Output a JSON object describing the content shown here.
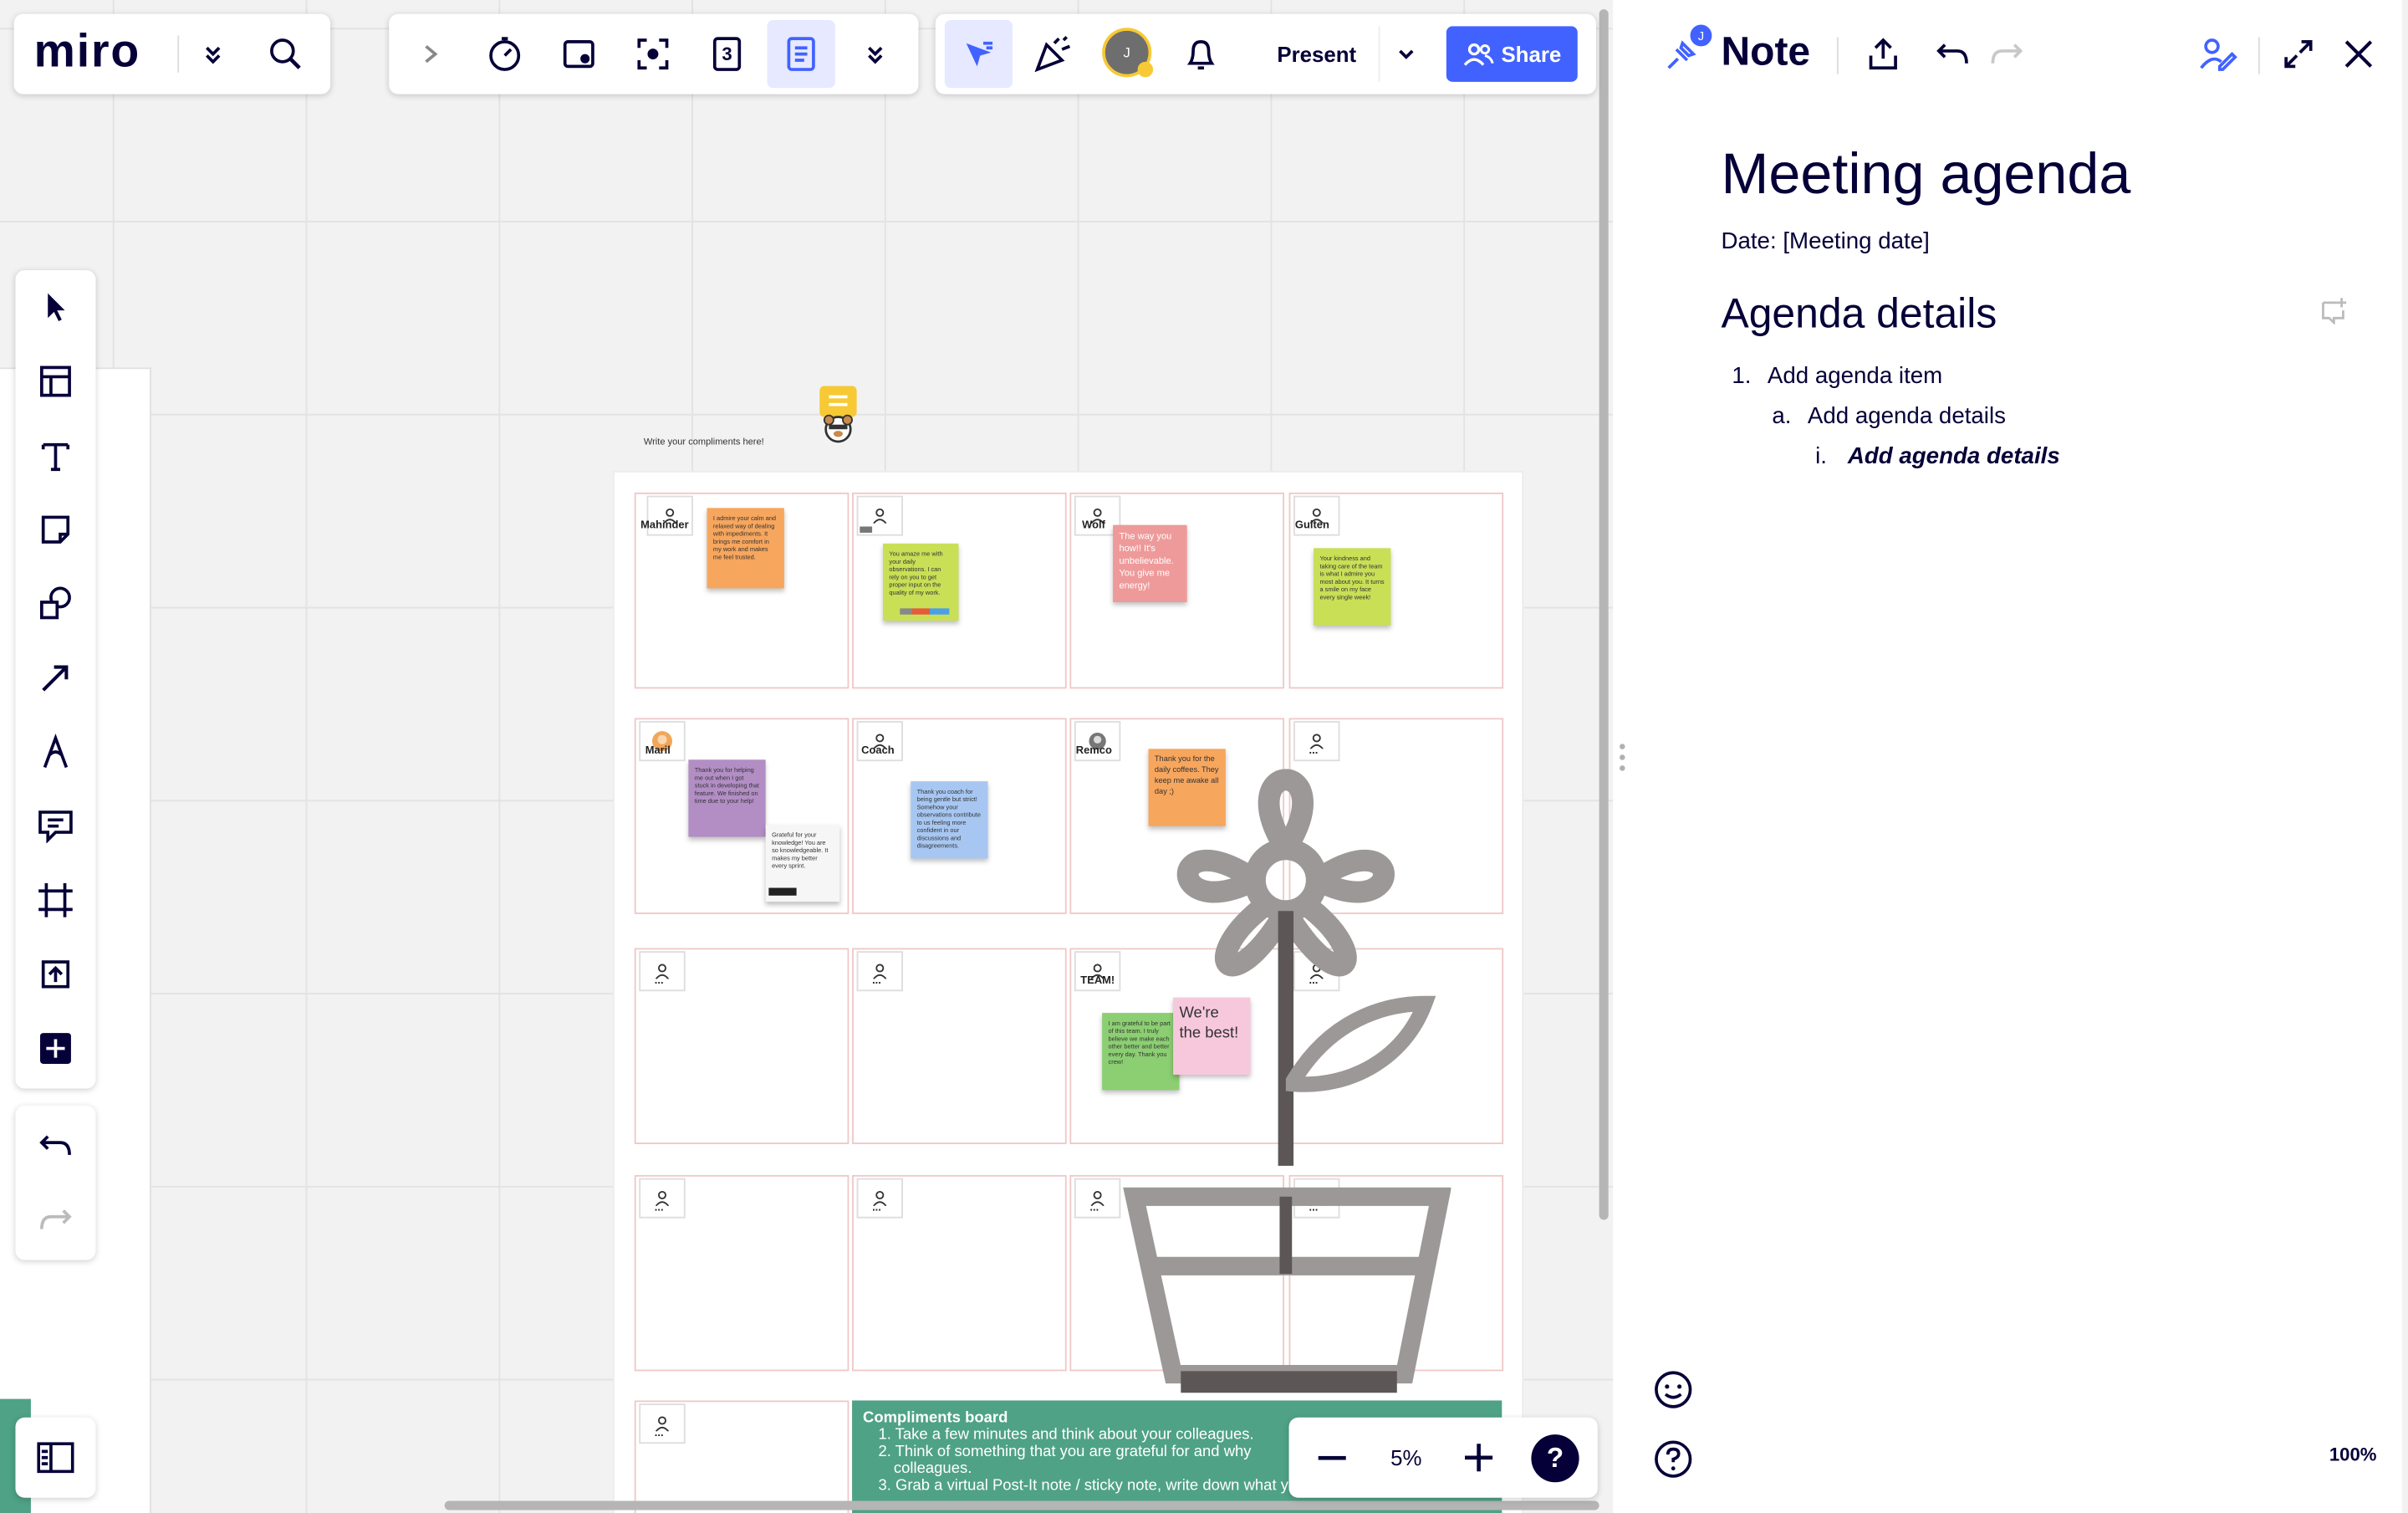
{
  "brand": {
    "logo": "miro"
  },
  "colors": {
    "accent": "#4262ff",
    "footer": "#4fa286",
    "flower": "#9c9898",
    "flower_dark": "#5c5656"
  },
  "toolbar": {
    "present_label": "Present",
    "share_label": "Share",
    "user_initial": "J",
    "timer_number": "3"
  },
  "board": {
    "instruction": "Write your compliments here!",
    "people": [
      {
        "name": "Mahinder"
      },
      {
        "name": ""
      },
      {
        "name": "Wolf"
      },
      {
        "name": "Gulten"
      },
      {
        "name": "Maril"
      },
      {
        "name": "Coach"
      },
      {
        "name": "Remco"
      },
      {
        "name": "..."
      },
      {
        "name": "..."
      },
      {
        "name": "..."
      },
      {
        "name": "TEAM!"
      },
      {
        "name": "..."
      },
      {
        "name": "..."
      },
      {
        "name": "..."
      },
      {
        "name": "..."
      },
      {
        "name": "..."
      },
      {
        "name": "..."
      }
    ],
    "stickies": {
      "mahinder": "I admire your calm and relaxed way of dealing with impediments. It brings me comfort in my work and makes me feel trusted.",
      "p2": "You amaze me with your daily observations. I can rely on you to get proper input on the quality of my work.",
      "wolf": "The way you how!! It's unbelievable. You give me energy!",
      "gulten": "Your kindness and taking care of the team is what I admire you most about you. It turns a smile on my face every single week!",
      "maril_1": "Thank you for helping me out when I got stuck in developing that feature. We finished on time due to your help!",
      "maril_2": "Grateful for your knowledge! You are so knowledgeable. It makes my better every sprint.",
      "coach": "Thank you coach for being gentle but strict! Somehow your observations contribute to us feeling more confident in our discussions and disagreements.",
      "remco": "Thank you for the daily coffees. They keep me awake all day ;)",
      "team_1": "I am grateful to be part of this team. I truly believe we make each other better and better every day. Thank you crew!",
      "team_2": "We're the best!"
    },
    "footer": {
      "title": "Compliments board",
      "items": [
        "Take a few minutes and think about your colleagues.",
        "Think of something that you are grateful for and why",
        "Grab a virtual Post-It note / sticky note, write down what you are grateful for"
      ],
      "item2_cont": "colleagues."
    }
  },
  "zoom": {
    "value": "5%"
  },
  "side": {
    "title": "Note",
    "doc_title": "Meeting agenda",
    "date_line": "Date: [Meeting date]",
    "section": "Agenda details",
    "list": [
      {
        "marker": "1.",
        "text": "Add agenda item"
      },
      {
        "marker": "a.",
        "text": "Add agenda details"
      },
      {
        "marker": "i.",
        "text": "Add agenda details"
      }
    ],
    "zoom_readout": "100%",
    "pin_badge": "J"
  }
}
